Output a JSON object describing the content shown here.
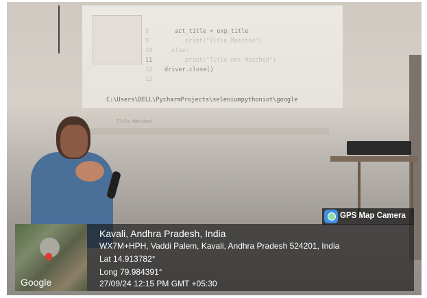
{
  "photo": {
    "code_lines": [
      "act_title = exp_title",
      "print(\"Title Matched\")",
      "else:",
      "print(\"Title not Matched\")",
      "driver.close()"
    ],
    "line_numbers": [
      "8",
      "9",
      "10",
      "11",
      "12",
      "13"
    ],
    "console_path": "C:\\Users\\DELL\\PycharmProjects\\seleniumpythoniot\\google",
    "console_output": "Title Matched"
  },
  "overlay": {
    "badge_label": "GPS Map Camera",
    "map_label": "Google",
    "title": "Kavali, Andhra Pradesh, India",
    "address": "WX7M+HPH, Vaddi Palem, Kavali, Andhra Pradesh 524201, India",
    "latitude": "Lat 14.913782°",
    "longitude": "Long 79.984391°",
    "datetime": "27/09/24 12:15 PM GMT +05:30"
  }
}
